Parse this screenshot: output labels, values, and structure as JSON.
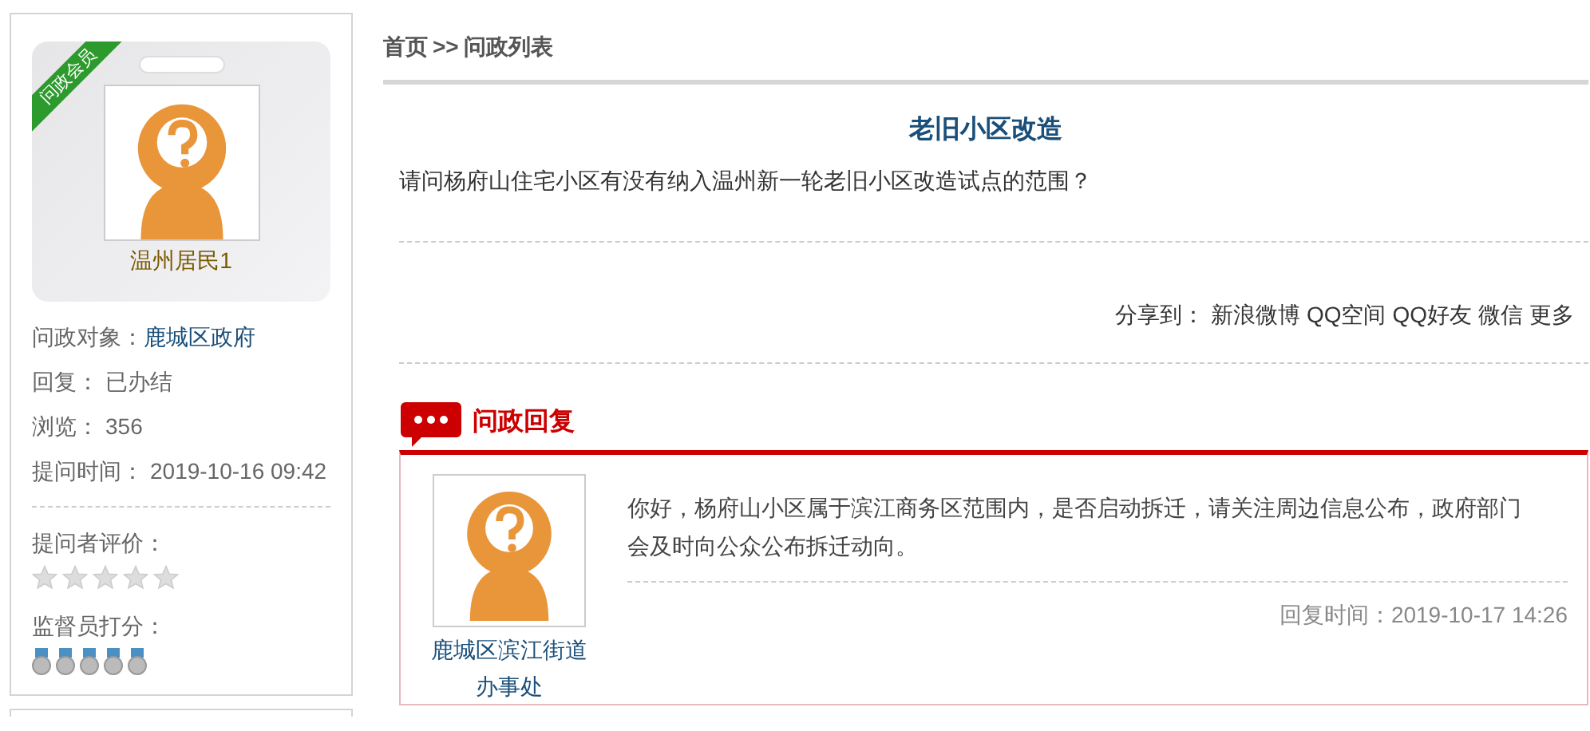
{
  "profile": {
    "ribbon": "问政会员",
    "name": "温州居民1"
  },
  "info": [
    {
      "label": "问政对象：",
      "value": "鹿城区政府",
      "kind": "link"
    },
    {
      "label": "回复：",
      "value": "已办结",
      "kind": "text"
    },
    {
      "label": "浏览：",
      "value": "356",
      "kind": "text"
    },
    {
      "label": "提问时间：",
      "value": "2019-10-16 09:42",
      "kind": "text"
    }
  ],
  "asker_rating": {
    "label": "提问者评价：",
    "stars": 0
  },
  "supervisor_score": {
    "label": "监督员打分：",
    "stars": 0
  },
  "breadcrumb": [
    {
      "label": "首页"
    },
    {
      "label": ">>"
    },
    {
      "label": "问政列表"
    }
  ],
  "question": {
    "title": "老旧小区改造",
    "body": "请问杨府山住宅小区有没有纳入温州新一轮老旧小区改造试点的范围？"
  },
  "share": {
    "label": "分享到：",
    "targets": [
      "新浪微博",
      "QQ空间",
      "QQ好友",
      "微信",
      "更多"
    ]
  },
  "reply_section": {
    "title": "问政回复"
  },
  "reply": {
    "responder": "鹿城区滨江街道办事处",
    "body": "你好，杨府山小区属于滨江商务区范围内，是否启动拆迁，请关注周边信息公布，政府部门会及时向公众公布拆迁动向。",
    "time": "回复时间：2019-10-17 14:26"
  }
}
